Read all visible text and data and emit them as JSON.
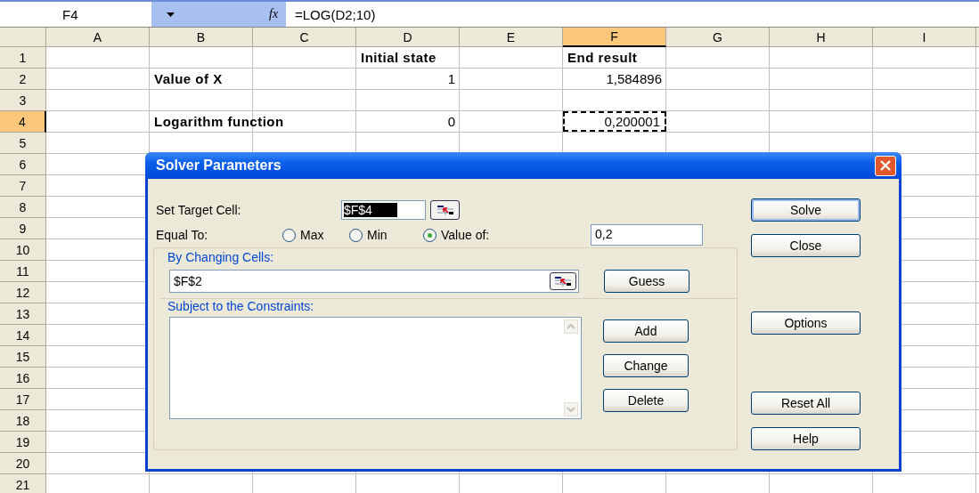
{
  "formula_bar": {
    "name_box": "F4",
    "fx": "fx",
    "formula": "=LOG(D2;10)"
  },
  "columns": [
    {
      "label": "A",
      "selected": false
    },
    {
      "label": "B",
      "selected": false
    },
    {
      "label": "C",
      "selected": false
    },
    {
      "label": "D",
      "selected": false
    },
    {
      "label": "E",
      "selected": false
    },
    {
      "label": "F",
      "selected": true
    },
    {
      "label": "G",
      "selected": false
    },
    {
      "label": "H",
      "selected": false
    },
    {
      "label": "I",
      "selected": false
    }
  ],
  "rows": [
    {
      "label": "1",
      "selected": false,
      "cells": [
        {
          "kind": "empty"
        },
        {
          "kind": "empty"
        },
        {
          "kind": "empty"
        },
        {
          "text": "Initial state",
          "kind": "label",
          "selected": false
        },
        {
          "kind": "empty"
        },
        {
          "text": "End result",
          "kind": "label",
          "selected": false
        }
      ]
    },
    {
      "label": "2",
      "selected": false,
      "cells": [
        {
          "kind": "empty"
        },
        {
          "text": "Value of X",
          "kind": "label",
          "selected": false
        },
        {
          "kind": "empty"
        },
        {
          "text": "1",
          "kind": "number",
          "selected": false
        },
        {
          "kind": "empty"
        },
        {
          "text": "1,584896",
          "kind": "number",
          "selected": false
        }
      ]
    },
    {
      "label": "3",
      "selected": false
    },
    {
      "label": "4",
      "selected": true,
      "cells": [
        {
          "kind": "empty"
        },
        {
          "text": "Logarithm function",
          "kind": "label",
          "selected": false
        },
        {
          "kind": "empty"
        },
        {
          "text": "0",
          "kind": "number",
          "selected": false
        },
        {
          "kind": "empty"
        },
        {
          "text": "0,200001",
          "kind": "number",
          "selected": true
        }
      ]
    },
    {
      "label": "5",
      "selected": false
    },
    {
      "label": "6",
      "selected": false
    },
    {
      "label": "7",
      "selected": false
    },
    {
      "label": "8",
      "selected": false
    },
    {
      "label": "9",
      "selected": false
    },
    {
      "label": "10",
      "selected": false
    },
    {
      "label": "11",
      "selected": false
    },
    {
      "label": "12",
      "selected": false
    },
    {
      "label": "13",
      "selected": false
    },
    {
      "label": "14",
      "selected": false
    },
    {
      "label": "15",
      "selected": false
    },
    {
      "label": "16",
      "selected": false
    },
    {
      "label": "17",
      "selected": false
    },
    {
      "label": "18",
      "selected": false
    },
    {
      "label": "19",
      "selected": false
    },
    {
      "label": "20",
      "selected": false
    },
    {
      "label": "21",
      "selected": false
    }
  ],
  "dialog": {
    "title": "Solver Parameters",
    "target_cell": {
      "label": "Set Target Cell:",
      "value": "$F$4",
      "selected": true
    },
    "equal_to": {
      "label": "Equal To:",
      "options": [
        {
          "label": "Max",
          "selected": false
        },
        {
          "label": "Min",
          "selected": false
        },
        {
          "label": "Value of:",
          "selected": true
        }
      ],
      "value": "0,2"
    },
    "changing_cells": {
      "legend": "By Changing Cells:",
      "value": "$F$2",
      "button": "Guess"
    },
    "constraints": {
      "legend": "Subject to the Constraints:",
      "buttons": [
        "Add",
        "Change",
        "Delete"
      ]
    },
    "side_buttons": [
      {
        "label": "Solve",
        "kind": "default"
      },
      {
        "label": "Close",
        "kind": "normal"
      },
      {
        "label": "Options",
        "kind": "normal"
      },
      {
        "label": "Reset All",
        "kind": "normal"
      },
      {
        "label": "Help",
        "kind": "normal"
      }
    ]
  }
}
